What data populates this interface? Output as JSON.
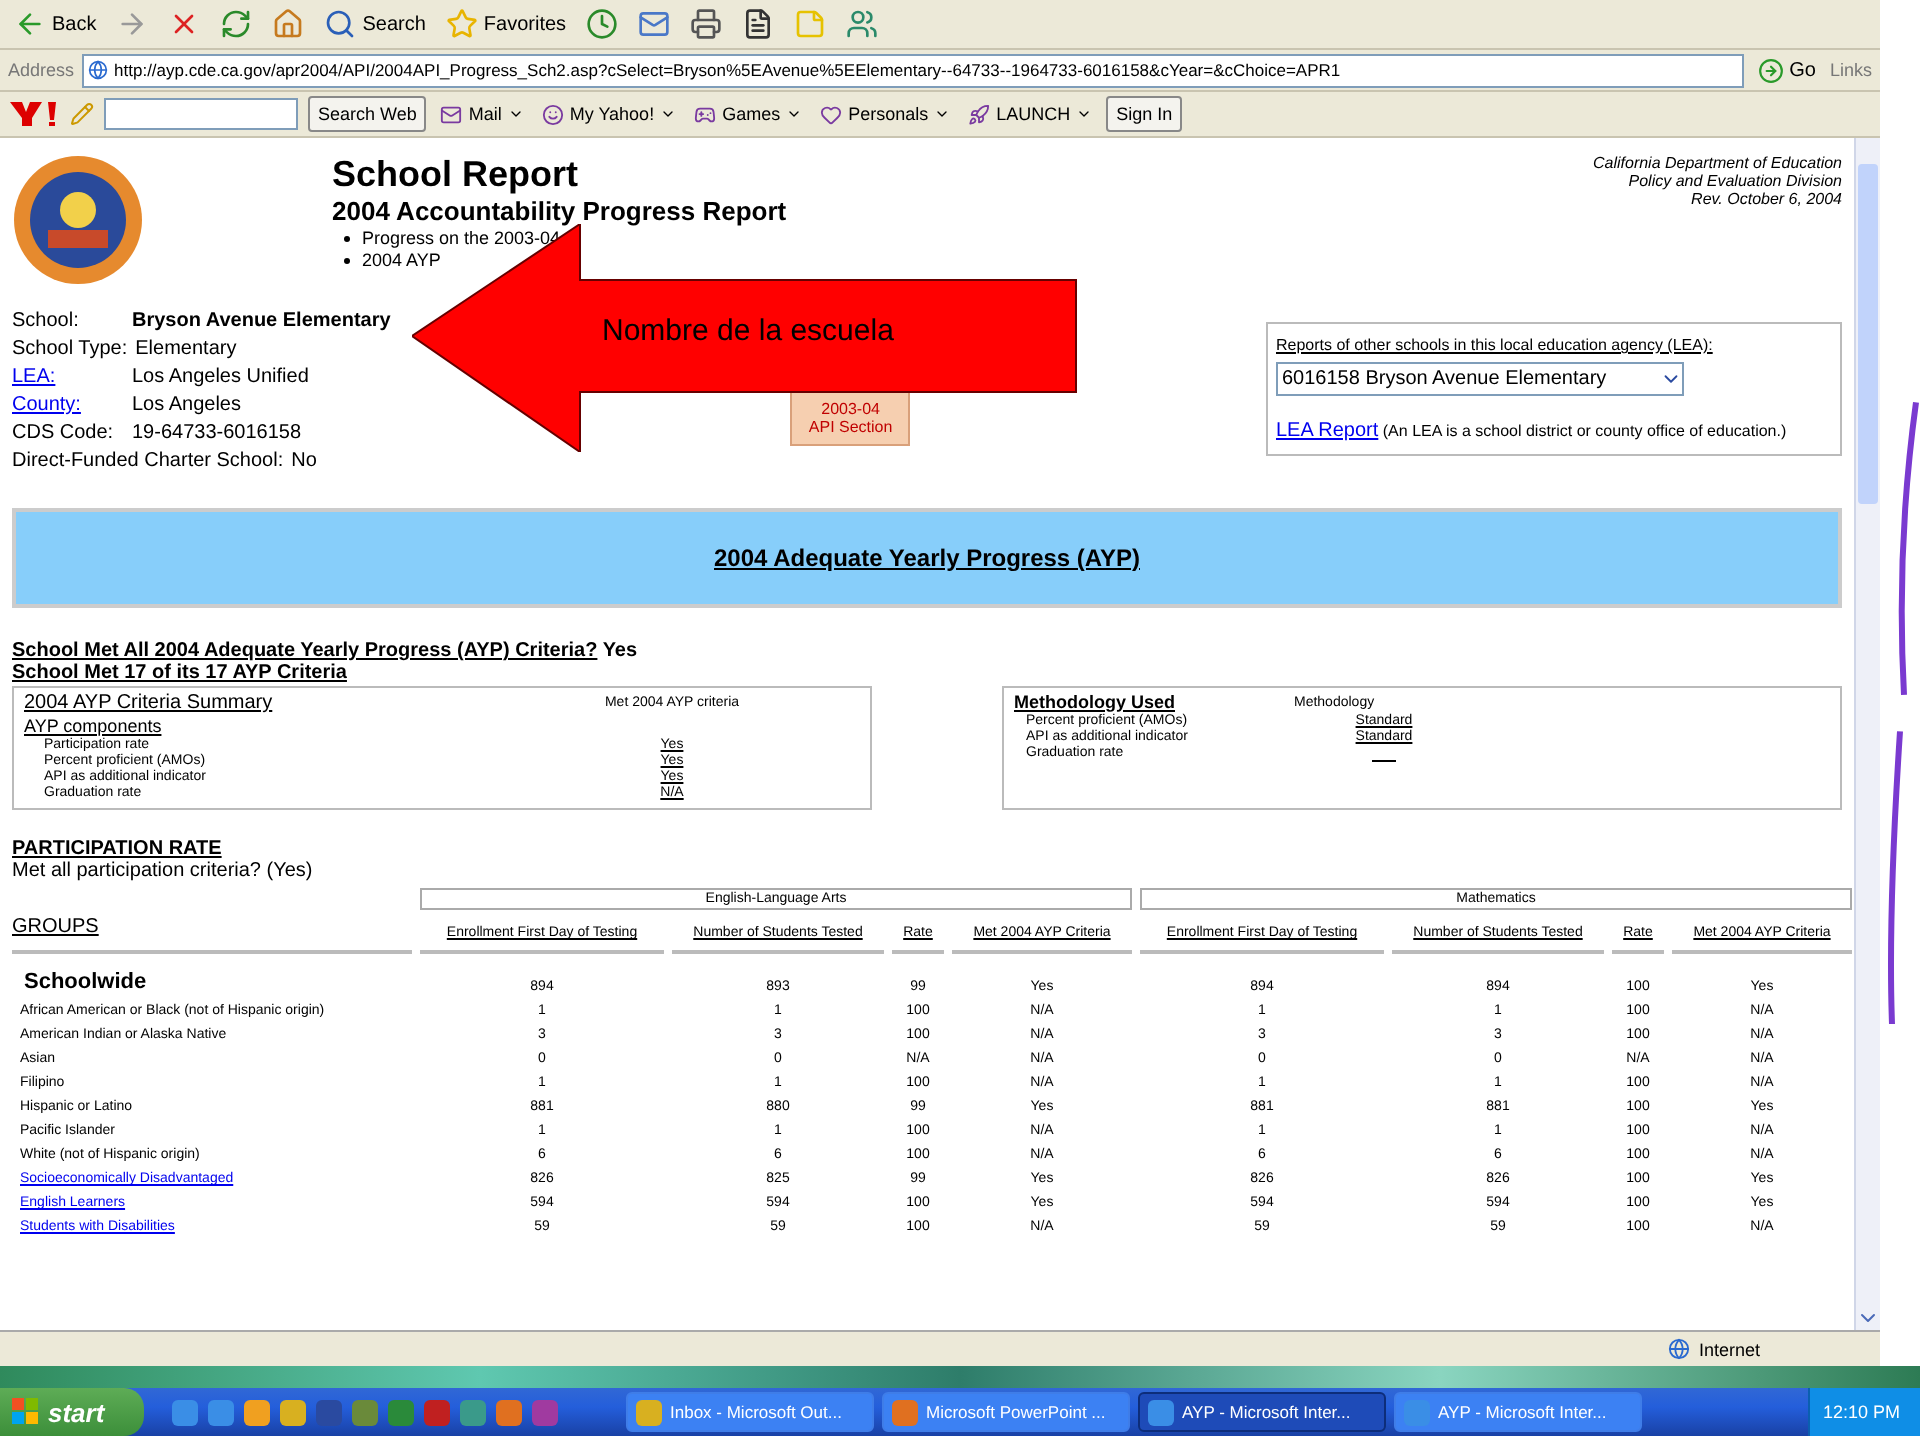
{
  "toolbar": {
    "buttons": [
      {
        "kind": "back",
        "label": "Back"
      },
      {
        "kind": "forward"
      },
      {
        "kind": "stop"
      },
      {
        "kind": "refresh"
      },
      {
        "kind": "home"
      },
      {
        "kind": "search",
        "label": "Search"
      },
      {
        "kind": "favorites",
        "label": "Favorites"
      },
      {
        "kind": "history"
      },
      {
        "kind": "mail"
      },
      {
        "kind": "print"
      },
      {
        "kind": "word"
      },
      {
        "kind": "note"
      },
      {
        "kind": "messenger"
      }
    ]
  },
  "address_bar": {
    "label": "Address",
    "url": "http://ayp.cde.ca.gov/apr2004/API/2004API_Progress_Sch2.asp?cSelect=Bryson%5EAvenue%5EElementary--64733--1964733-6016158&cYear=&cChoice=APR1",
    "go": "Go",
    "links": "Links"
  },
  "yahoo_bar": {
    "search_button": "Search Web",
    "items": [
      "Mail",
      "My Yahoo!",
      "Games",
      "Personals",
      "LAUNCH"
    ],
    "sign_in": "Sign In"
  },
  "report": {
    "title": "School Report",
    "subtitle": "2004 Accountability Progress Report",
    "bullets": [
      "Progress on the 2003-04",
      "2004 AYP"
    ],
    "agency": [
      "California Department of Education",
      "Policy and Evaluation Division",
      "Rev. October 6, 2004"
    ],
    "school_info": [
      {
        "label": "School:",
        "value": "Bryson Avenue Elementary",
        "link": false,
        "bold": true
      },
      {
        "label": "School Type:",
        "value": "Elementary",
        "link": false,
        "bold": false
      },
      {
        "label": "LEA:",
        "value": "Los Angeles Unified",
        "link": true,
        "bold": false
      },
      {
        "label": "County:",
        "value": "Los Angeles",
        "link": true,
        "bold": false
      },
      {
        "label": "CDS Code:",
        "value": "19-64733-6016158",
        "link": false,
        "bold": false
      },
      {
        "label": "Direct-Funded Charter School:",
        "value": "No",
        "link": false,
        "bold": false
      }
    ],
    "api_button": [
      "2003-04",
      "API Section"
    ],
    "lea_box": {
      "label": "Reports of other schools in this local education agency (LEA):",
      "select": "6016158 Bryson Avenue Elementary",
      "link": "LEA Report",
      "note": "(An LEA is a school district or county office of education.)"
    },
    "banner": "2004 Adequate Yearly Progress (AYP)",
    "met_all": {
      "question": "School Met All 2004 Adequate Yearly Progress (AYP) Criteria?",
      "answer": "Yes"
    },
    "met_count": "School Met  17  of its  17  AYP Criteria",
    "summary": {
      "title": "2004 AYP Criteria Summary",
      "components": "AYP components",
      "column": "Met 2004 AYP criteria",
      "rows": [
        {
          "name": "Participation rate",
          "value": "Yes"
        },
        {
          "name": "Percent proficient (AMOs)",
          "value": "Yes"
        },
        {
          "name": "API as additional indicator",
          "value": "Yes"
        },
        {
          "name": "Graduation rate",
          "value": "N/A"
        }
      ]
    },
    "methodology": {
      "title": "Methodology Used",
      "column": "Methodology",
      "rows": [
        {
          "name": "Percent proficient (AMOs)",
          "value": "Standard"
        },
        {
          "name": "API as additional indicator",
          "value": "Standard"
        },
        {
          "name": "Graduation rate"
        }
      ]
    },
    "participation": {
      "heading": "PARTICIPATION RATE",
      "note": "Met all participation criteria? (Yes)"
    },
    "table": {
      "groups_heading": "GROUPS",
      "subjects": [
        "English-Language Arts",
        "Mathematics"
      ],
      "columns": [
        "Enrollment First Day of Testing",
        "Number of Students Tested",
        "Rate",
        "Met 2004 AYP Criteria",
        "Enrollment First Day of Testing",
        "Number of Students Tested",
        "Rate",
        "Met 2004 AYP Criteria"
      ],
      "rows": [
        {
          "kind": "total",
          "name": "Schoolwide",
          "values": [
            "894",
            "893",
            "99",
            "Yes",
            "894",
            "894",
            "100",
            "Yes"
          ]
        },
        {
          "kind": "group",
          "name": "African American or Black (not of Hispanic origin)",
          "values": [
            "1",
            "1",
            "100",
            "N/A",
            "1",
            "1",
            "100",
            "N/A"
          ]
        },
        {
          "kind": "group",
          "name": "American Indian or Alaska Native",
          "values": [
            "3",
            "3",
            "100",
            "N/A",
            "3",
            "3",
            "100",
            "N/A"
          ]
        },
        {
          "kind": "group",
          "name": "Asian",
          "values": [
            "0",
            "0",
            "N/A",
            "N/A",
            "0",
            "0",
            "N/A",
            "N/A"
          ]
        },
        {
          "kind": "group",
          "name": "Filipino",
          "values": [
            "1",
            "1",
            "100",
            "N/A",
            "1",
            "1",
            "100",
            "N/A"
          ]
        },
        {
          "kind": "group",
          "name": "Hispanic or Latino",
          "values": [
            "881",
            "880",
            "99",
            "Yes",
            "881",
            "881",
            "100",
            "Yes"
          ]
        },
        {
          "kind": "group",
          "name": "Pacific Islander",
          "values": [
            "1",
            "1",
            "100",
            "N/A",
            "1",
            "1",
            "100",
            "N/A"
          ]
        },
        {
          "kind": "group",
          "name": "White (not of Hispanic origin)",
          "values": [
            "6",
            "6",
            "100",
            "N/A",
            "6",
            "6",
            "100",
            "N/A"
          ]
        },
        {
          "kind": "link",
          "name": "Socioeconomically Disadvantaged",
          "values": [
            "826",
            "825",
            "99",
            "Yes",
            "826",
            "826",
            "100",
            "Yes"
          ]
        },
        {
          "kind": "link",
          "name": "English Learners",
          "values": [
            "594",
            "594",
            "100",
            "Yes",
            "594",
            "594",
            "100",
            "Yes"
          ]
        },
        {
          "kind": "link",
          "name": "Students with Disabilities",
          "values": [
            "59",
            "59",
            "100",
            "N/A",
            "59",
            "59",
            "100",
            "N/A"
          ]
        }
      ]
    }
  },
  "callout": "Nombre de la escuela",
  "status_bar": {
    "zone": "Internet"
  },
  "taskbar": {
    "start": "start",
    "tasks": [
      {
        "kind": "outlook",
        "label": "Inbox - Microsoft Out...",
        "selected": false
      },
      {
        "kind": "powerpoint",
        "label": "Microsoft PowerPoint ...",
        "selected": false
      },
      {
        "kind": "ie",
        "label": "AYP - Microsoft Inter...",
        "selected": true
      },
      {
        "kind": "ie",
        "label": "AYP - Microsoft Inter...",
        "selected": false
      }
    ],
    "clock": "12:10 PM"
  }
}
